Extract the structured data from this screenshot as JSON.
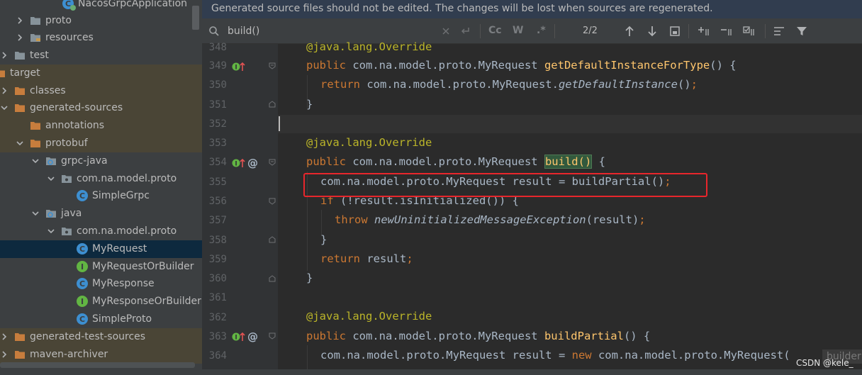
{
  "project_tree": {
    "rows": [
      {
        "label": "NacosGrpcApplication",
        "icon": "spring-class-icon"
      },
      {
        "label": "proto",
        "icon": "folder-icon"
      },
      {
        "label": "resources",
        "icon": "folder-icon"
      },
      {
        "label": "test",
        "icon": "folder-icon"
      },
      {
        "label": "target",
        "icon": "folder-orange-icon"
      },
      {
        "label": "classes",
        "icon": "folder-orange-icon"
      },
      {
        "label": "generated-sources",
        "icon": "folder-orange-icon"
      },
      {
        "label": "annotations",
        "icon": "folder-orange-icon"
      },
      {
        "label": "protobuf",
        "icon": "folder-orange-icon"
      },
      {
        "label": "grpc-java",
        "icon": "source-root-icon"
      },
      {
        "label": "com.na.model.proto",
        "icon": "package-icon"
      },
      {
        "label": "SimpleGrpc",
        "icon": "class-icon",
        "glyph": "C"
      },
      {
        "label": "java",
        "icon": "source-root-icon"
      },
      {
        "label": "com.na.model.proto",
        "icon": "package-icon"
      },
      {
        "label": "MyRequest",
        "icon": "class-icon",
        "glyph": "C"
      },
      {
        "label": "MyRequestOrBuilder",
        "icon": "interface-icon",
        "glyph": "I"
      },
      {
        "label": "MyResponse",
        "icon": "class-icon",
        "glyph": "C"
      },
      {
        "label": "MyResponseOrBuilder",
        "icon": "interface-icon",
        "glyph": "I"
      },
      {
        "label": "SimpleProto",
        "icon": "class-icon",
        "glyph": "C"
      },
      {
        "label": "generated-test-sources",
        "icon": "folder-orange-icon"
      },
      {
        "label": "maven-archiver",
        "icon": "folder-orange-icon"
      }
    ]
  },
  "editor": {
    "banner": "Generated source files should not be edited. The changes will be lost when sources are regenerated.",
    "search": {
      "query": "build()",
      "match_case_label": "Cc",
      "words_label": "W",
      "regex_label": ".*",
      "match_count": "2/2"
    },
    "line_numbers": [
      "348",
      "349",
      "350",
      "351",
      "352",
      "353",
      "354",
      "355",
      "356",
      "357",
      "358",
      "359",
      "360",
      "361",
      "362",
      "363",
      "364"
    ],
    "code": {
      "l348": "@java.lang.Override",
      "l349_kw": "public ",
      "l349_type": "com.na.model.proto.MyRequest ",
      "l349_fn": "getDefaultInstanceForType",
      "l349_rest": "() {",
      "l350_kw": "return ",
      "l350_type": "com.na.model.proto.MyRequest.",
      "l350_it": "getDefaultInstance",
      "l350_rest": "()",
      "l350_semi": ";",
      "l351": "}",
      "l353": "@java.lang.Override",
      "l354_kw": "public ",
      "l354_type": "com.na.model.proto.MyRequest ",
      "l354_fn": "build()",
      "l354_rest": " {",
      "l355_code": "com.na.model.proto.MyRequest result = buildPartial()",
      "l355_semi": ";",
      "l356_kw": "if ",
      "l356_rest": "(!result.isInitialized()) {",
      "l357_kw": "throw ",
      "l357_it": "newUninitializedMessageException",
      "l357_rest": "(result)",
      "l357_semi": ";",
      "l358": "}",
      "l359_kw": "return ",
      "l359_rest": "result",
      "l359_semi": ";",
      "l360": "}",
      "l362": "@java.lang.Override",
      "l363_kw": "public ",
      "l363_type": "com.na.model.proto.MyRequest ",
      "l363_fn": "buildPartial",
      "l363_rest": "() {",
      "l364_code": "com.na.model.proto.MyRequest result = ",
      "l364_kw": "new ",
      "l364_rest": "com.na.model.proto.MyRequest(",
      "param_hint": "builder"
    }
  },
  "watermark": "CSDN @kele_",
  "colors": {
    "keyword": "#cc7832",
    "annotation": "#bbb529",
    "method": "#ffc66d",
    "text": "#a9b7c6",
    "highlight_box": "#e8262c"
  }
}
